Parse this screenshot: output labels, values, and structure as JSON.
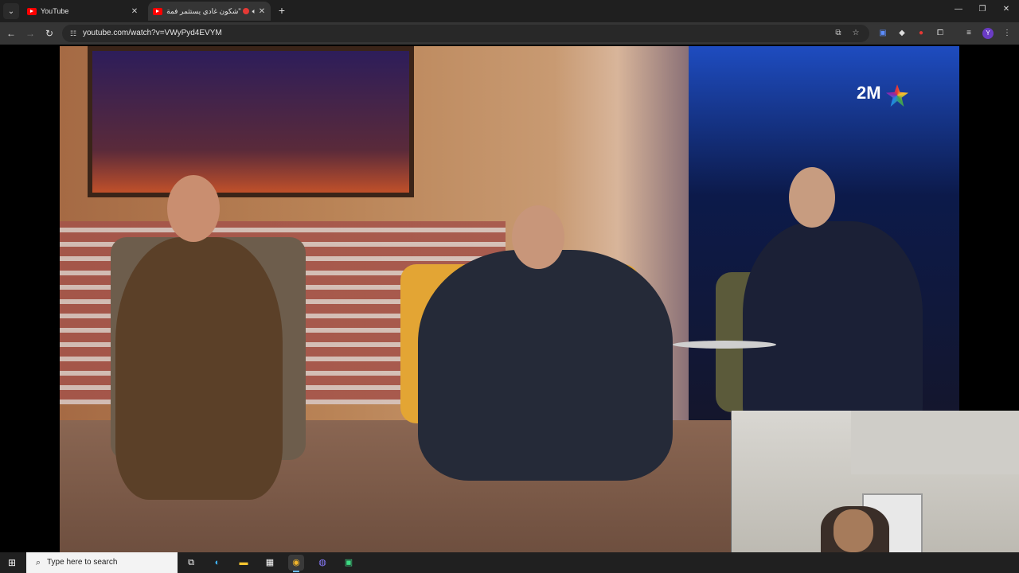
{
  "browser": {
    "tabs": [
      {
        "title": "YouTube",
        "icon": "youtube-favicon",
        "active": false
      },
      {
        "title": "\"شكون غادي يستثمر فمة",
        "icon": "youtube-favicon",
        "active": true,
        "recording": true,
        "audio": true
      }
    ],
    "new_tab_label": "+",
    "url": "youtube.com/watch?v=VWyPyd4EVYM",
    "window_controls": {
      "minimize": "—",
      "restore": "❐",
      "close": "✕"
    },
    "profile_initial": "Y"
  },
  "video": {
    "channel_logo": "2M"
  },
  "taskbar": {
    "search_placeholder": "Type here to search",
    "apps": [
      "task-view",
      "edge",
      "file-explorer",
      "store",
      "chrome",
      "discord",
      "app"
    ]
  },
  "colors": {
    "youtube_red": "#ff0000",
    "recording_red": "#e53935",
    "tab_active": "#353535",
    "tab_strip": "#1f1f1f",
    "taskbar": "#202020"
  }
}
